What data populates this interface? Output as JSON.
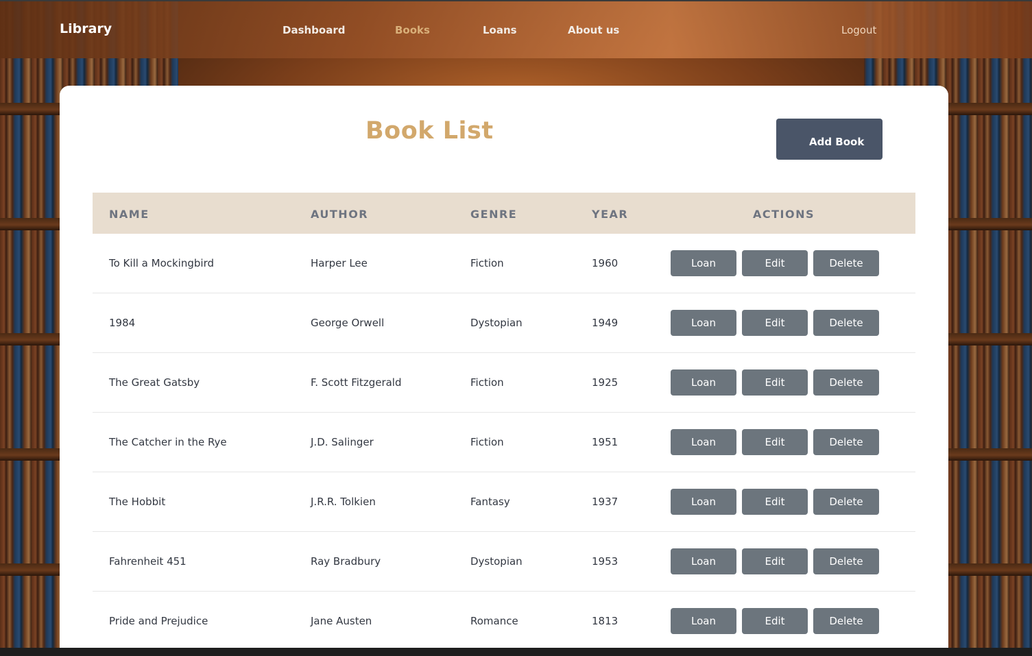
{
  "navbar": {
    "brand": "Library",
    "links": [
      "Dashboard",
      "Books",
      "Loans",
      "About us"
    ],
    "active": "Books",
    "logout": "Logout"
  },
  "main": {
    "title": "Book List",
    "add_button": "Add Book",
    "columns": [
      "NAME",
      "AUTHOR",
      "GENRE",
      "YEAR",
      "ACTIONS"
    ],
    "rows": [
      {
        "name": "To Kill a Mockingbird",
        "author": "Harper Lee",
        "genre": "Fiction",
        "year": "1960"
      },
      {
        "name": "1984",
        "author": "George Orwell",
        "genre": "Dystopian",
        "year": "1949"
      },
      {
        "name": "The Great Gatsby",
        "author": "F. Scott Fitzgerald",
        "genre": "Fiction",
        "year": "1925"
      },
      {
        "name": "The Catcher in the Rye",
        "author": "J.D. Salinger",
        "genre": "Fiction",
        "year": "1951"
      },
      {
        "name": "The Hobbit",
        "author": "J.R.R. Tolkien",
        "genre": "Fantasy",
        "year": "1937"
      },
      {
        "name": "Fahrenheit 451",
        "author": "Ray Bradbury",
        "genre": "Dystopian",
        "year": "1953"
      },
      {
        "name": "Pride and Prejudice",
        "author": "Jane Austen",
        "genre": "Romance",
        "year": "1813"
      }
    ],
    "actions": {
      "loan": "Loan",
      "edit": "Edit",
      "delete": "Delete"
    }
  },
  "colors": {
    "accent": "#d2a86c",
    "add_button": "#4a5568",
    "action_button": "#6c757d",
    "table_header": "#e8ddcf"
  }
}
